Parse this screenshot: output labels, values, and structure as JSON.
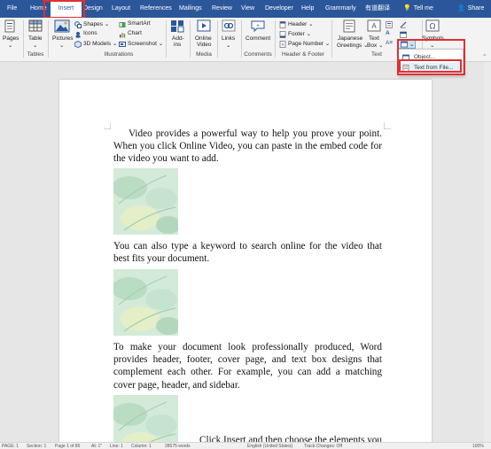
{
  "tabs": [
    "File",
    "Home",
    "Insert",
    "Design",
    "Layout",
    "References",
    "Mailings",
    "Review",
    "View",
    "Developer",
    "Help",
    "Grammarly",
    "有道翻译",
    "Tell me",
    "Share"
  ],
  "ribbon": {
    "pages": "Pages",
    "table": "Table",
    "pictures": "Pictures",
    "shapes": "Shapes",
    "icons": "Icons",
    "models3d": "3D Models",
    "smartart": "SmartArt",
    "chart": "Chart",
    "screenshot": "Screenshot",
    "addins": "Add-",
    "addins2": "ins",
    "online_video_1": "Online",
    "online_video_2": "Video",
    "links": "Links",
    "comment": "Comment",
    "header": "Header",
    "footer": "Footer",
    "page_number": "Page Number",
    "japanese_1": "Japanese",
    "japanese_2": "Greetings",
    "textbox_1": "Text",
    "textbox_2": "Box",
    "symbols": "Symbols",
    "groups": {
      "tables": "Tables",
      "illustrations": "Illustrations",
      "media": "Media",
      "comments": "Comments",
      "header_footer": "Header & Footer",
      "text": "Text"
    }
  },
  "object_menu": {
    "object": "Object...",
    "text_from_file": "Text from File..."
  },
  "document": {
    "p1": "Video provides a powerful way to help you prove your point. When you click Online Video, you can paste in the embed code for the video you want to add.",
    "p2": "You can also type a keyword to search online for the video that best fits your document.",
    "p3": "To make your document look professionally produced, Word provides header, footer, cover page, and text box designs that complement each other. For example, you can add a matching cover page, header, and sidebar.",
    "p4": "Click Insert and then choose the elements you want"
  },
  "status": {
    "page": "PAGE: 1",
    "section": "Section: 1",
    "page_of": "Page 1 of 86",
    "at": "At: 1\"",
    "line": "Line: 1",
    "column": "Column: 1",
    "words": "28575 words",
    "language": "English (United States)",
    "track": "Track Changes: Off",
    "zoom": "100%"
  }
}
